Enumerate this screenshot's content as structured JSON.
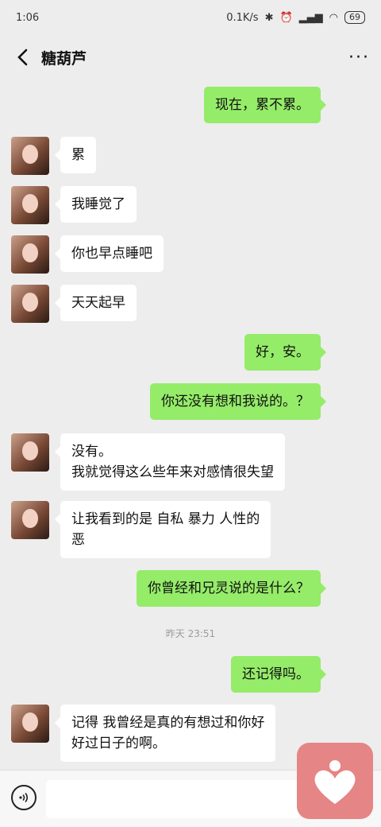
{
  "status_bar": {
    "time": "1:06",
    "speed": "0.1K/s",
    "battery": "69"
  },
  "header": {
    "back_icon": "chevron-left",
    "title": "糖葫芦",
    "more_label": "···"
  },
  "messages": [
    {
      "side": "right",
      "text": "现在，累不累。"
    },
    {
      "side": "left",
      "text": "累"
    },
    {
      "side": "left",
      "text": "我睡觉了"
    },
    {
      "side": "left",
      "text": "你也早点睡吧"
    },
    {
      "side": "left",
      "text": "天天起早"
    },
    {
      "side": "right",
      "text": "好，安。"
    },
    {
      "side": "right",
      "text": "你还没有想和我说的。？"
    },
    {
      "side": "left",
      "text": "没有。\n我就觉得这么些年来对感情很失望"
    },
    {
      "side": "left",
      "text": "让我看到的是  自私   暴力   人性的\n恶"
    },
    {
      "side": "right",
      "text": "你曾经和兄灵说的是什么？"
    },
    {
      "side": "right",
      "text": "还记得吗。"
    },
    {
      "side": "left",
      "text": "记得   我曾经是真的有想过和你好\n好过日子的啊。"
    }
  ],
  "timestamp": "昨天 23:51",
  "bottom_bar": {
    "voice_icon": "voice-icon",
    "input_value": ""
  },
  "floating_button": {
    "icon": "heart-person-icon",
    "color": "#e58585"
  },
  "colors": {
    "background": "#ededed",
    "sent_bubble": "#95ec69",
    "received_bubble": "#ffffff"
  }
}
